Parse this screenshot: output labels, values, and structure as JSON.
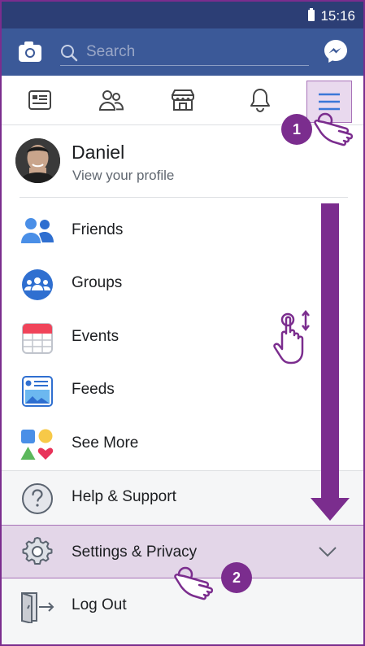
{
  "status_bar": {
    "time": "15:16"
  },
  "search": {
    "placeholder": "Search"
  },
  "tabs": [
    "news-feed",
    "friends",
    "marketplace",
    "notifications",
    "menu"
  ],
  "profile": {
    "name": "Daniel",
    "subtitle": "View your profile"
  },
  "menu": {
    "items": [
      {
        "label": "Friends",
        "icon": "friends-icon"
      },
      {
        "label": "Groups",
        "icon": "groups-icon"
      },
      {
        "label": "Events",
        "icon": "events-icon"
      },
      {
        "label": "Feeds",
        "icon": "feeds-icon"
      },
      {
        "label": "See More",
        "icon": "see-more-icon"
      }
    ],
    "help_label": "Help & Support",
    "settings_label": "Settings & Privacy",
    "logout_label": "Log Out"
  },
  "steps": [
    "1",
    "2"
  ],
  "colors": {
    "brand": "#3b5998",
    "accent": "#7b2d8e",
    "highlight": "#e3d6e8"
  }
}
